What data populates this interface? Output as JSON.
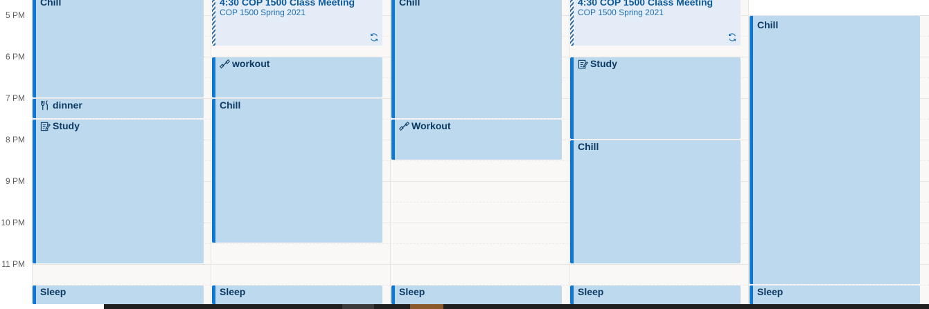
{
  "time_labels": [
    "5 PM",
    "6 PM",
    "7 PM",
    "8 PM",
    "9 PM",
    "10 PM",
    "11 PM"
  ],
  "days": [
    {
      "chill": "Chill",
      "dinner": "dinner",
      "study": "Study",
      "sleep": "Sleep"
    },
    {
      "meeting_title": "4:30 COP 1500 Class Meeting",
      "meeting_sub": "COP 1500 Spring 2021",
      "workout": "workout",
      "chill": "Chill",
      "sleep": "Sleep"
    },
    {
      "chill": "Chill",
      "workout": "Workout",
      "sleep": "Sleep"
    },
    {
      "meeting_title": "4:30 COP 1500 Class Meeting",
      "meeting_sub": "COP 1500 Spring 2021",
      "study": "Study",
      "chill": "Chill",
      "sleep": "Sleep"
    },
    {
      "chill": "Chill",
      "sleep": "Sleep"
    }
  ],
  "icons": {
    "dinner": "utensils-icon",
    "study": "edit-note-icon",
    "workout": "dumbbell-icon",
    "recurring": "recurring-icon"
  },
  "colors": {
    "event_fill": "#bcd9ee",
    "event_accent": "#0f78d4",
    "meeting_fill": "#e4edf7"
  }
}
